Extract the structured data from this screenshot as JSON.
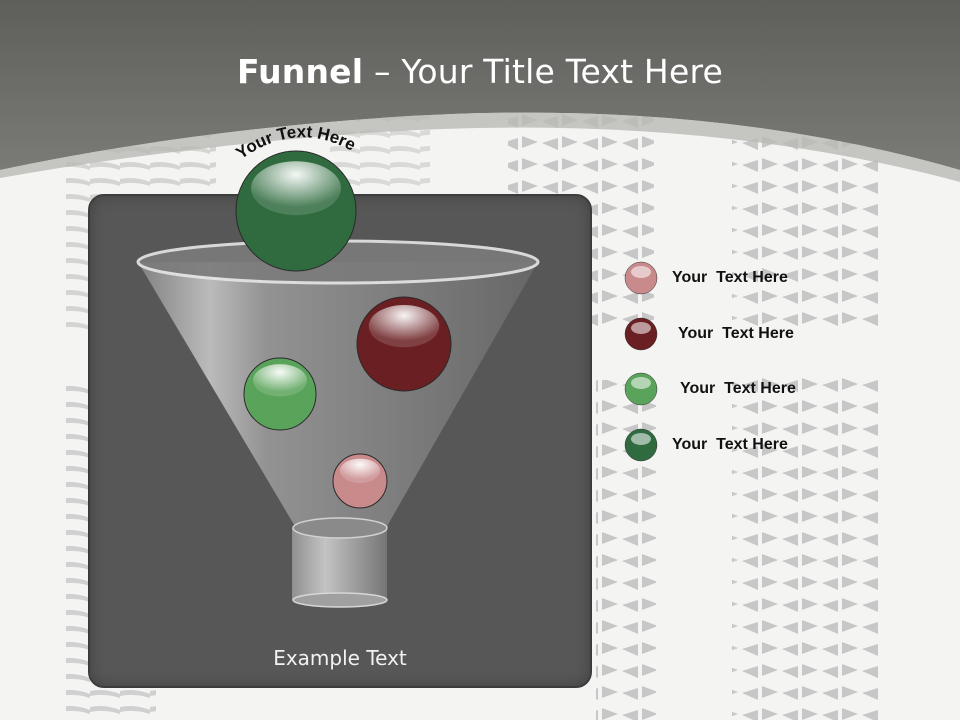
{
  "title": {
    "bold": "Funnel",
    "rest": " – Your Title Text Here"
  },
  "funnel": {
    "top_label": "Your Text Here",
    "bottom_label": "Example Text",
    "balls": [
      {
        "name": "dark-green-ball",
        "color": "#2f6b3e"
      },
      {
        "name": "dark-red-ball",
        "color": "#6a1f22"
      },
      {
        "name": "green-ball",
        "color": "#5aa35a"
      },
      {
        "name": "pink-ball",
        "color": "#c98a8c"
      }
    ]
  },
  "legend": [
    {
      "label": "Your  Text Here",
      "color": "#c98a8c"
    },
    {
      "label": "Your  Text Here",
      "color": "#6a1f22"
    },
    {
      "label": "Your  Text Here",
      "color": "#5aa35a"
    },
    {
      "label": "Your  Text Here",
      "color": "#2f6b3e"
    }
  ]
}
